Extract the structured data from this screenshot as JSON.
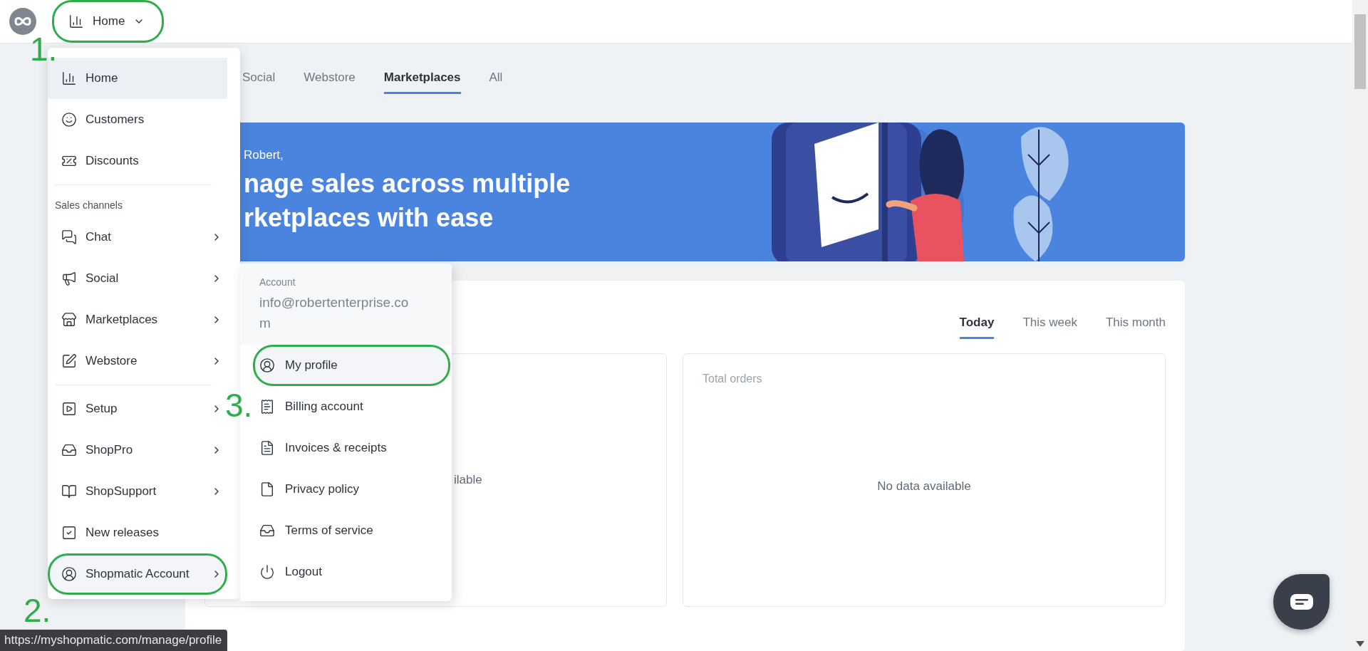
{
  "topbar": {
    "nav_button": {
      "label": "Home",
      "outlined": true
    }
  },
  "main_tabs": [
    {
      "label": "Social",
      "selected": false
    },
    {
      "label": "Webstore",
      "selected": false
    },
    {
      "label": "Marketplaces",
      "selected": true
    },
    {
      "label": "All",
      "selected": false
    }
  ],
  "banner": {
    "greeting": "Robert,",
    "headline": [
      "nage sales across multiple",
      "rketplaces with ease"
    ]
  },
  "period_tabs": [
    {
      "label": "Today",
      "selected": true
    },
    {
      "label": "This week",
      "selected": false
    },
    {
      "label": "This month",
      "selected": false
    }
  ],
  "cards": [
    {
      "message": "ilable"
    },
    {
      "title": "Total orders",
      "message": "No data available"
    }
  ],
  "nav_menu": {
    "sections": [
      {
        "items": [
          {
            "label": "Home",
            "selected": true,
            "submenu": false,
            "hovered": false,
            "outlined": false
          },
          {
            "label": "Customers",
            "selected": false,
            "submenu": false,
            "hovered": false,
            "outlined": false
          },
          {
            "label": "Discounts",
            "selected": false,
            "submenu": false,
            "hovered": false,
            "outlined": false
          }
        ]
      },
      {
        "header": "Sales channels",
        "items": [
          {
            "label": "Chat",
            "selected": false,
            "submenu": true,
            "hovered": false,
            "outlined": false
          },
          {
            "label": "Social",
            "selected": false,
            "submenu": true,
            "hovered": false,
            "outlined": false
          },
          {
            "label": "Marketplaces",
            "selected": false,
            "submenu": true,
            "hovered": false,
            "outlined": false
          },
          {
            "label": "Webstore",
            "selected": false,
            "submenu": true,
            "hovered": false,
            "outlined": false
          }
        ]
      },
      {
        "items": [
          {
            "label": "Setup",
            "selected": false,
            "submenu": true,
            "hovered": false,
            "outlined": false
          },
          {
            "label": "ShopPro",
            "selected": false,
            "submenu": true,
            "hovered": false,
            "outlined": false
          },
          {
            "label": "ShopSupport",
            "selected": false,
            "submenu": true,
            "hovered": false,
            "outlined": false
          },
          {
            "label": "New releases",
            "selected": false,
            "submenu": false,
            "hovered": false,
            "outlined": false
          },
          {
            "label": "Shopmatic Account",
            "selected": false,
            "submenu": true,
            "hovered": true,
            "outlined": true
          }
        ]
      }
    ]
  },
  "account_menu": {
    "heading": "Account",
    "email": "info@robertenterprise.com",
    "items": [
      {
        "label": "My profile",
        "hovered": true,
        "outlined": true
      },
      {
        "label": "Billing account",
        "hovered": false,
        "outlined": false
      },
      {
        "label": "Invoices & receipts",
        "hovered": false,
        "outlined": false
      },
      {
        "label": "Privacy policy",
        "hovered": false,
        "outlined": false
      },
      {
        "label": "Terms of service",
        "hovered": false,
        "outlined": false
      },
      {
        "label": "Logout",
        "hovered": false,
        "outlined": false
      }
    ]
  },
  "annotations": [
    {
      "label": "1."
    },
    {
      "label": "2."
    },
    {
      "label": "3."
    }
  ],
  "status_url": "https://myshopmatic.com/manage/profile"
}
